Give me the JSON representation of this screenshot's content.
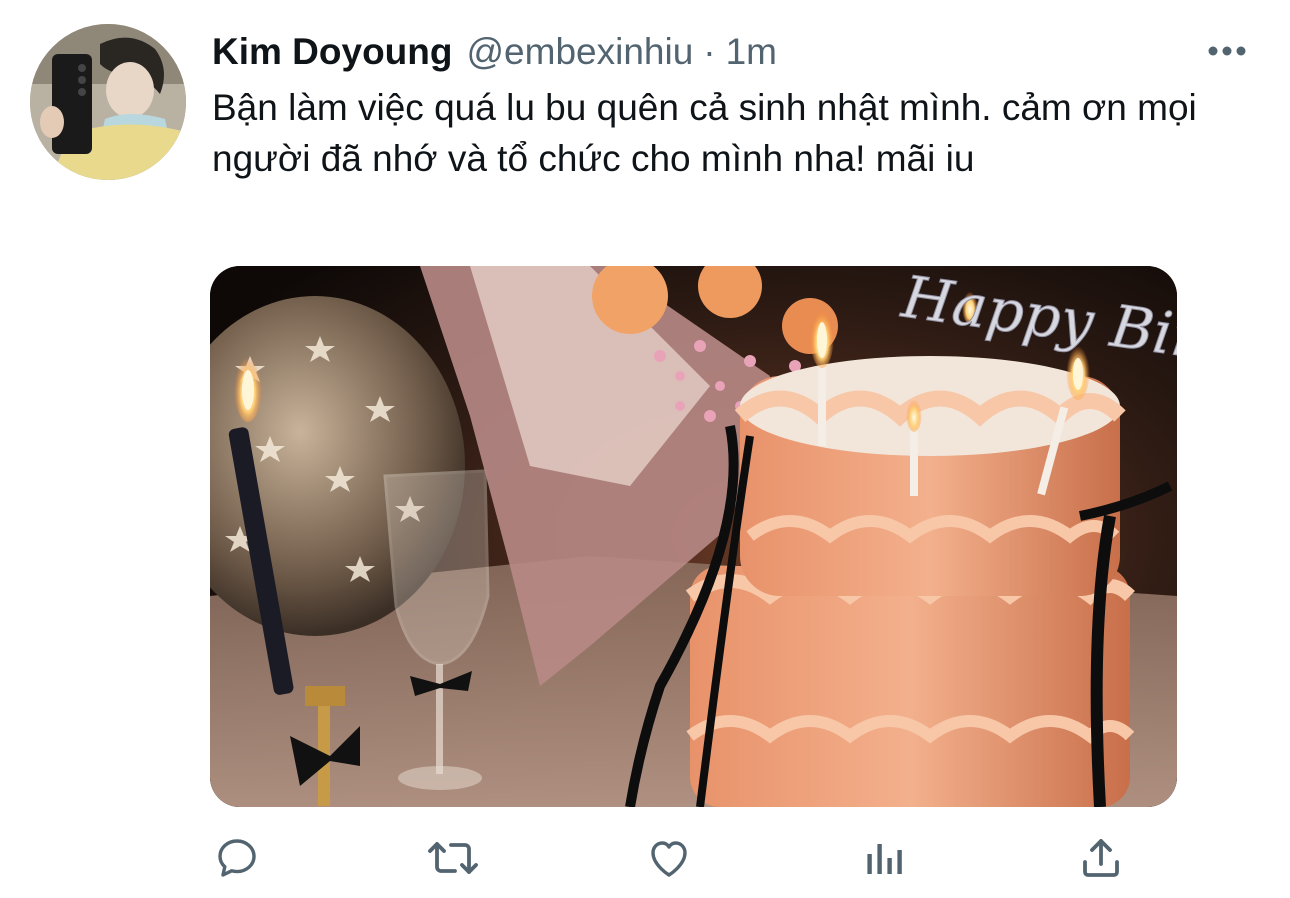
{
  "tweet": {
    "author": {
      "display_name": "Kim Doyoung",
      "handle": "@embexinhiu",
      "separator": "·",
      "timestamp": "1m"
    },
    "text": "Bận làm việc quá lu bu quên cả sinh nhật mình. cảm ơn mọi người đã nhớ và tổ chức cho mình nha! mãi iu",
    "media": {
      "topper_text": "Happy Birthday"
    },
    "icons": {
      "more": "more-horizontal-icon",
      "reply": "reply-icon",
      "retweet": "retweet-icon",
      "like": "like-icon",
      "analytics": "analytics-icon",
      "share": "share-icon"
    },
    "colors": {
      "text_primary": "#0f1419",
      "text_secondary": "#536471",
      "icon": "#536471"
    }
  }
}
